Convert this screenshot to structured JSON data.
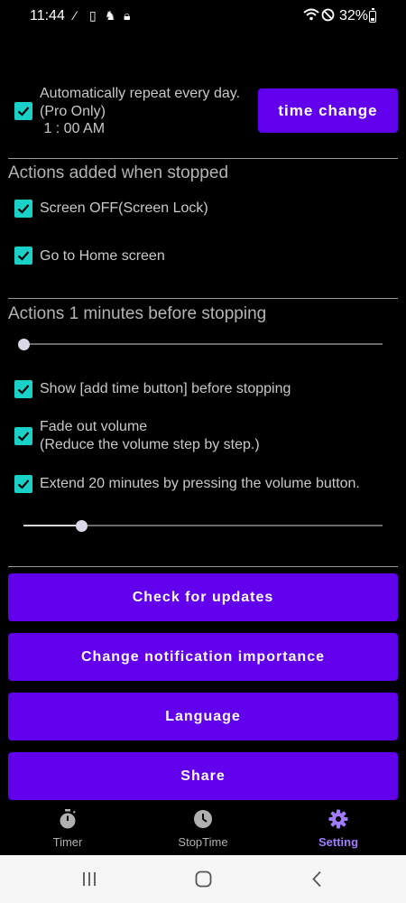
{
  "status_bar": {
    "time": "11:44",
    "battery": "32%"
  },
  "repeat": {
    "line1": "Automatically repeat every day.",
    "line2": "(Pro Only)",
    "line3": " 1 : 00 AM",
    "checked": true
  },
  "time_change_label": "time change",
  "stopped_section": {
    "title": "Actions added when stopped",
    "screen_off": "Screen OFF(Screen Lock)",
    "home_screen": "Go to Home screen"
  },
  "before_section": {
    "title": "Actions 1 minutes before stopping",
    "minutes_slider_value": 0,
    "show_add_time": "Show [add time button] before stopping",
    "fade_line1": "Fade out volume",
    "fade_line2": "(Reduce the volume step by step.)",
    "extend": "Extend 20 minutes by pressing the volume button.",
    "extend_slider_value": 0.16
  },
  "buttons": {
    "updates": "Check for updates",
    "notification": "Change notification importance",
    "language": "Language",
    "share": "Share"
  },
  "nav": {
    "timer": "Timer",
    "stoptime": "StopTime",
    "setting": "Setting",
    "active": "setting"
  },
  "colors": {
    "accent": "#6200ee",
    "checkbox": "#19d1c6",
    "active_nav": "#a17cff"
  }
}
